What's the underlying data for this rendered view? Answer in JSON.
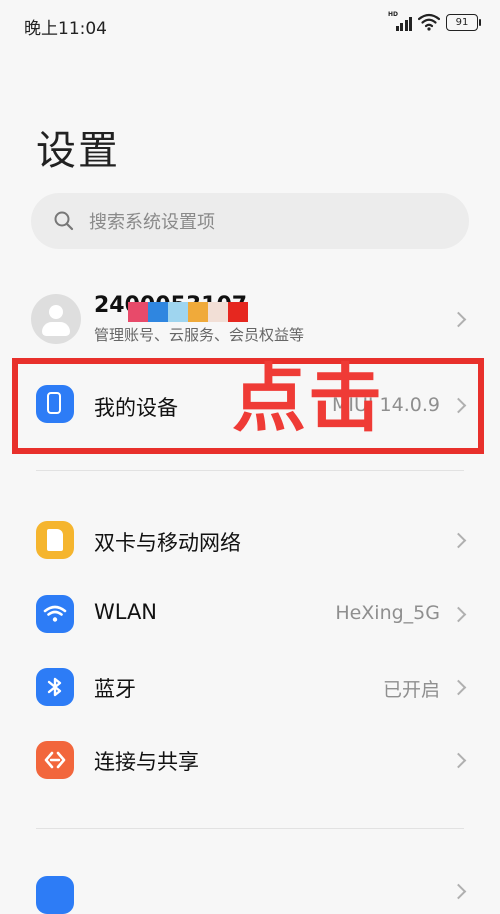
{
  "status_bar": {
    "time": "晚上11:04",
    "network_badge": "HD",
    "battery": "91"
  },
  "header": {
    "title": "设置"
  },
  "search": {
    "placeholder": "搜索系统设置项"
  },
  "account": {
    "name": "2400053107",
    "subtitle": "管理账号、云服务、会员权益等"
  },
  "annotation": {
    "click_text": "点击",
    "color": "#e8302b"
  },
  "items": [
    {
      "label": "我的设备",
      "value": "MIUI 14.0.9",
      "icon": "device-icon",
      "color": "#2d7cf6"
    },
    {
      "label": "双卡与移动网络",
      "value": "",
      "icon": "sim-card-icon",
      "color": "#f5b52e"
    },
    {
      "label": "WLAN",
      "value": "HeXing_5G",
      "icon": "wifi-icon",
      "color": "#2d7cf6"
    },
    {
      "label": "蓝牙",
      "value": "已开启",
      "icon": "bluetooth-icon",
      "color": "#2d7cf6"
    },
    {
      "label": "连接与共享",
      "value": "",
      "icon": "share-icon",
      "color": "#f2663c"
    },
    {
      "label": "",
      "value": "",
      "icon": "app-icon",
      "color": "#2d7cf6"
    }
  ]
}
